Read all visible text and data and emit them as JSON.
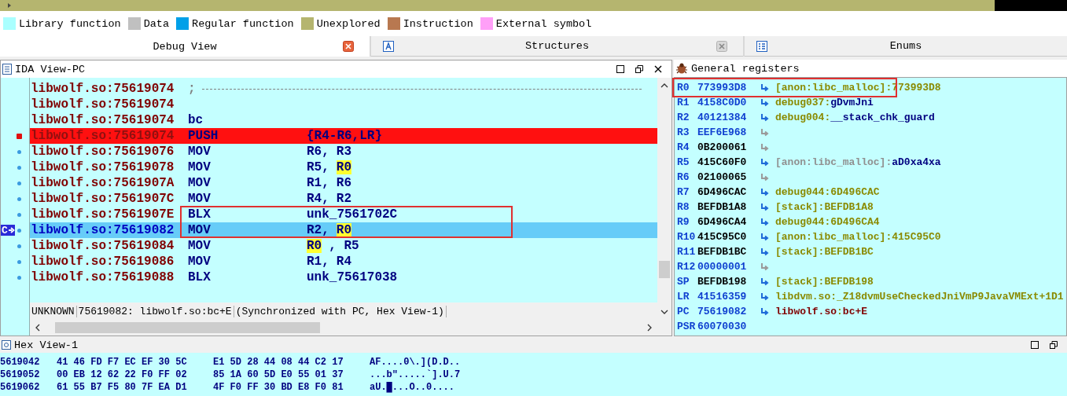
{
  "legend": [
    {
      "label": "Library function",
      "color": "#aaffff"
    },
    {
      "label": "Data",
      "color": "#c0c0c0"
    },
    {
      "label": "Regular function",
      "color": "#00a0e8"
    },
    {
      "label": "Unexplored",
      "color": "#b5b56f"
    },
    {
      "label": "Instruction",
      "color": "#b87850"
    },
    {
      "label": "External symbol",
      "color": "#ff9ff8"
    }
  ],
  "tabs": [
    {
      "label": "Debug View",
      "selected": true,
      "closable": true
    },
    {
      "label": "Structures",
      "selected": false,
      "closable": true
    },
    {
      "label": "Enums",
      "selected": false,
      "closable": false
    }
  ],
  "ida_view": {
    "title": "IDA View-PC",
    "lines": [
      {
        "dot": false,
        "breakpoint": false,
        "current": false,
        "address": "libwolf.so:75619074",
        "kind": "separator",
        "mnemonic": ";",
        "annotated": false
      },
      {
        "dot": false,
        "breakpoint": false,
        "current": false,
        "address": "libwolf.so:75619074",
        "kind": "code",
        "annotated": false
      },
      {
        "dot": false,
        "breakpoint": false,
        "current": false,
        "address": "libwolf.so:75619074",
        "kind": "code",
        "mnemonic": "bc",
        "annotated": false
      },
      {
        "dot": false,
        "breakpoint": true,
        "current": false,
        "address": "libwolf.so:75619074",
        "kind": "code",
        "mnemonic": "PUSH",
        "operands": [
          {
            "text": "{R4-R6,LR}",
            "highlighted": false
          }
        ],
        "annotated": false
      },
      {
        "dot": true,
        "breakpoint": false,
        "current": false,
        "address": "libwolf.so:75619076",
        "kind": "code",
        "mnemonic": "MOV",
        "operands": [
          {
            "text": "R6,",
            "highlighted": false
          },
          {
            "text": "R3",
            "highlighted": false
          }
        ],
        "annotated": false
      },
      {
        "dot": true,
        "breakpoint": false,
        "current": false,
        "address": "libwolf.so:75619078",
        "kind": "code",
        "mnemonic": "MOV",
        "operands": [
          {
            "text": "R5,",
            "highlighted": false
          },
          {
            "text": "R0",
            "highlighted": true
          }
        ],
        "annotated": false
      },
      {
        "dot": true,
        "breakpoint": false,
        "current": false,
        "address": "libwolf.so:7561907A",
        "kind": "code",
        "mnemonic": "MOV",
        "operands": [
          {
            "text": "R1,",
            "highlighted": false
          },
          {
            "text": "R6",
            "highlighted": false
          }
        ],
        "annotated": false
      },
      {
        "dot": true,
        "breakpoint": false,
        "current": false,
        "address": "libwolf.so:7561907C",
        "kind": "code",
        "mnemonic": "MOV",
        "operands": [
          {
            "text": "R4,",
            "highlighted": false
          },
          {
            "text": "R2",
            "highlighted": false
          }
        ],
        "annotated": false
      },
      {
        "dot": true,
        "breakpoint": false,
        "current": false,
        "address": "libwolf.so:7561907E",
        "kind": "code",
        "mnemonic": "BLX",
        "operands": [
          {
            "text": "unk_7561702C",
            "highlighted": false
          }
        ],
        "annotated": true
      },
      {
        "dot": true,
        "breakpoint": false,
        "current": true,
        "pc_label": "C",
        "address": "libwolf.so:75619082",
        "kind": "code",
        "mnemonic": "MOV",
        "operands": [
          {
            "text": "R2,",
            "highlighted": false
          },
          {
            "text": "R0",
            "highlighted": true
          }
        ],
        "annotated": true
      },
      {
        "dot": true,
        "breakpoint": false,
        "current": false,
        "address": "libwolf.so:75619084",
        "kind": "code",
        "mnemonic": "MOV",
        "operands": [
          {
            "text": "R0",
            "highlighted": true
          },
          {
            "text": ", R5",
            "highlighted": false
          }
        ],
        "annotated": false
      },
      {
        "dot": true,
        "breakpoint": false,
        "current": false,
        "address": "libwolf.so:75619086",
        "kind": "code",
        "mnemonic": "MOV",
        "operands": [
          {
            "text": "R1,",
            "highlighted": false
          },
          {
            "text": "R4",
            "highlighted": false
          }
        ],
        "annotated": false
      },
      {
        "dot": true,
        "breakpoint": false,
        "current": false,
        "address": "libwolf.so:75619088",
        "kind": "code",
        "mnemonic": "BLX",
        "operands": [
          {
            "text": "unk_75617038",
            "highlighted": false
          }
        ],
        "annotated": false
      }
    ],
    "status": [
      "UNKNOWN",
      "75619082: libwolf.so:bc+E",
      "(Synchronized with PC, Hex View-1)"
    ]
  },
  "registers": {
    "title": "General registers",
    "rows": [
      {
        "name": "R0",
        "value": "773993D8",
        "changed": true,
        "pointer": true,
        "annotated": true,
        "comment": [
          {
            "text": "[anon:libc_malloc]:773993D8",
            "kind": "segment"
          }
        ]
      },
      {
        "name": "R1",
        "value": "4158C0D0",
        "changed": true,
        "pointer": true,
        "annotated": false,
        "comment": [
          {
            "text": "debug037:",
            "kind": "segment"
          },
          {
            "text": "gDvmJni",
            "kind": "name"
          }
        ]
      },
      {
        "name": "R2",
        "value": "40121384",
        "changed": true,
        "pointer": true,
        "annotated": false,
        "comment": [
          {
            "text": "debug004:",
            "kind": "segment"
          },
          {
            "text": "__stack_chk_guard",
            "kind": "name"
          }
        ]
      },
      {
        "name": "R3",
        "value": "EEF6E968",
        "changed": true,
        "pointer": false,
        "annotated": false
      },
      {
        "name": "R4",
        "value": "0B200061",
        "changed": false,
        "pointer": false,
        "annotated": false
      },
      {
        "name": "R5",
        "value": "415C60F0",
        "changed": false,
        "pointer": true,
        "annotated": false,
        "comment": [
          {
            "text": "[anon:libc_malloc]:",
            "kind": "unloaded"
          },
          {
            "text": "aD0xa4xa",
            "kind": "name"
          }
        ]
      },
      {
        "name": "R6",
        "value": "02100065",
        "changed": false,
        "pointer": false,
        "annotated": false
      },
      {
        "name": "R7",
        "value": "6D496CAC",
        "changed": false,
        "pointer": true,
        "annotated": false,
        "comment": [
          {
            "text": "debug044:6D496CAC",
            "kind": "segment"
          }
        ]
      },
      {
        "name": "R8",
        "value": "BEFDB1A8",
        "changed": false,
        "pointer": true,
        "annotated": false,
        "comment": [
          {
            "text": "[stack]:BEFDB1A8",
            "kind": "segment"
          }
        ]
      },
      {
        "name": "R9",
        "value": "6D496CA4",
        "changed": false,
        "pointer": true,
        "annotated": false,
        "comment": [
          {
            "text": "debug044:6D496CA4",
            "kind": "segment"
          }
        ]
      },
      {
        "name": "R10",
        "value": "415C95C0",
        "changed": false,
        "pointer": true,
        "annotated": false,
        "comment": [
          {
            "text": "[anon:libc_malloc]:415C95C0",
            "kind": "segment"
          }
        ]
      },
      {
        "name": "R11",
        "value": "BEFDB1BC",
        "changed": false,
        "pointer": true,
        "annotated": false,
        "comment": [
          {
            "text": "[stack]:BEFDB1BC",
            "kind": "segment"
          }
        ]
      },
      {
        "name": "R12",
        "value": "00000001",
        "changed": true,
        "pointer": false,
        "annotated": false
      },
      {
        "name": "SP",
        "value": "BEFDB198",
        "changed": false,
        "pointer": true,
        "annotated": false,
        "comment": [
          {
            "text": "[stack]:BEFDB198",
            "kind": "segment"
          }
        ]
      },
      {
        "name": "LR",
        "value": "41516359",
        "changed": true,
        "pointer": true,
        "annotated": false,
        "comment": [
          {
            "text": "libdvm.so:_Z18dvmUseCheckedJniVmP9JavaVMExt+1D1",
            "kind": "segment"
          }
        ]
      },
      {
        "name": "PC",
        "value": "75619082",
        "changed": true,
        "pointer": true,
        "annotated": false,
        "comment": [
          {
            "text": "libwolf.so",
            "kind": "code"
          },
          {
            "text": ":",
            "kind": "segment"
          },
          {
            "text": "bc+E",
            "kind": "code"
          }
        ]
      },
      {
        "name": "PSR",
        "value": "60070030",
        "changed": true,
        "annotated": false
      }
    ]
  },
  "hex_view": {
    "title": "Hex View-1",
    "rows": [
      {
        "address": "5619042",
        "bytes": [
          "41 46 FD F7 EC EF 30 5C",
          "E1 5D 28 44 08 44 C2 17"
        ],
        "ascii": "AF....0\\.](D.D.."
      },
      {
        "address": "5619052",
        "bytes": [
          "00 EB 12 62 22 F0 FF 02",
          "85 1A 60 5D E0 55 01 37"
        ],
        "ascii": "...b\".....`].U.7"
      },
      {
        "address": "5619062",
        "bytes": [
          "61 55 B7 F5 80 7F EA D1",
          "4F F0 FF 30 BD E8 F0 81"
        ],
        "ascii": "aU.█...O..0...."
      }
    ]
  }
}
